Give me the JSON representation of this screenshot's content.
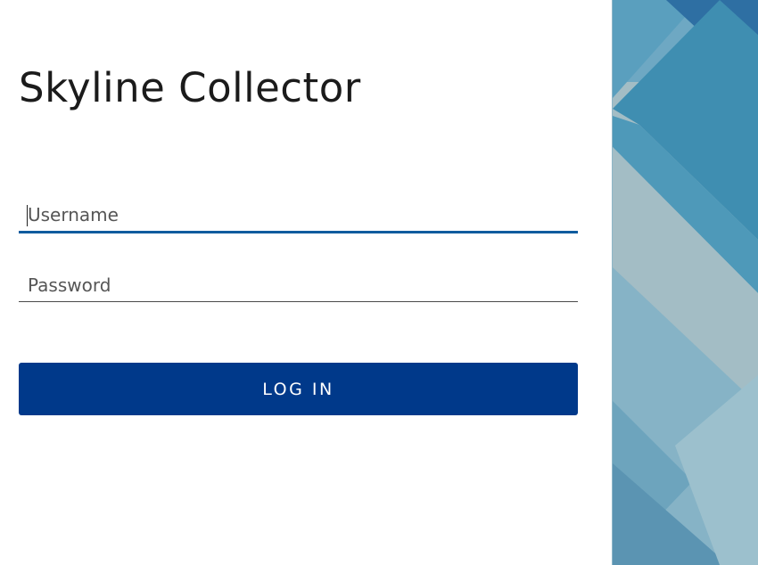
{
  "app": {
    "title": "Skyline Collector"
  },
  "form": {
    "username_placeholder": "Username",
    "username_value": "",
    "password_placeholder": "Password",
    "password_value": "",
    "login_label": "LOG IN"
  },
  "colors": {
    "button": "#00398a",
    "focus_underline": "#0f5b9e",
    "art_primary": "#3f8eb1",
    "art_secondary": "#a3bdc5"
  }
}
